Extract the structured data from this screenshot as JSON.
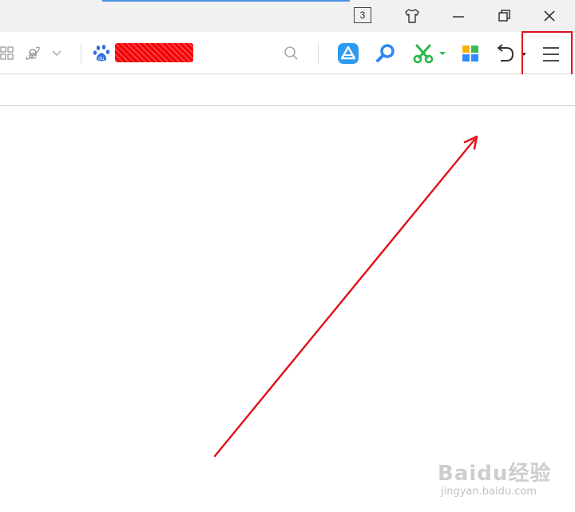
{
  "titlebar": {
    "tab_count": "3",
    "icons": [
      "skin-icon",
      "minimize-icon",
      "restore-icon",
      "close-icon"
    ]
  },
  "toolbar": {
    "icons": [
      "apps-grid-icon",
      "ie-compat-icon",
      "chevron-down-icon",
      "baidu-paw-icon",
      "search-icon",
      "app-store-icon",
      "magnifier-icon",
      "scissors-icon",
      "dropdown-arrow-icon",
      "app-center-icon",
      "undo-icon",
      "undo-dropdown-icon",
      "menu-icon"
    ],
    "colors": {
      "menu_highlight": "#e0121a",
      "app_store": "#2e9bf0",
      "magnifier": "#2e86f0",
      "scissors": "#2bb84a"
    }
  },
  "annotation": {
    "arrow_color": "#e0121a"
  },
  "watermark": {
    "brand": "Baidu经验",
    "url": "jingyan.baidu.com"
  }
}
